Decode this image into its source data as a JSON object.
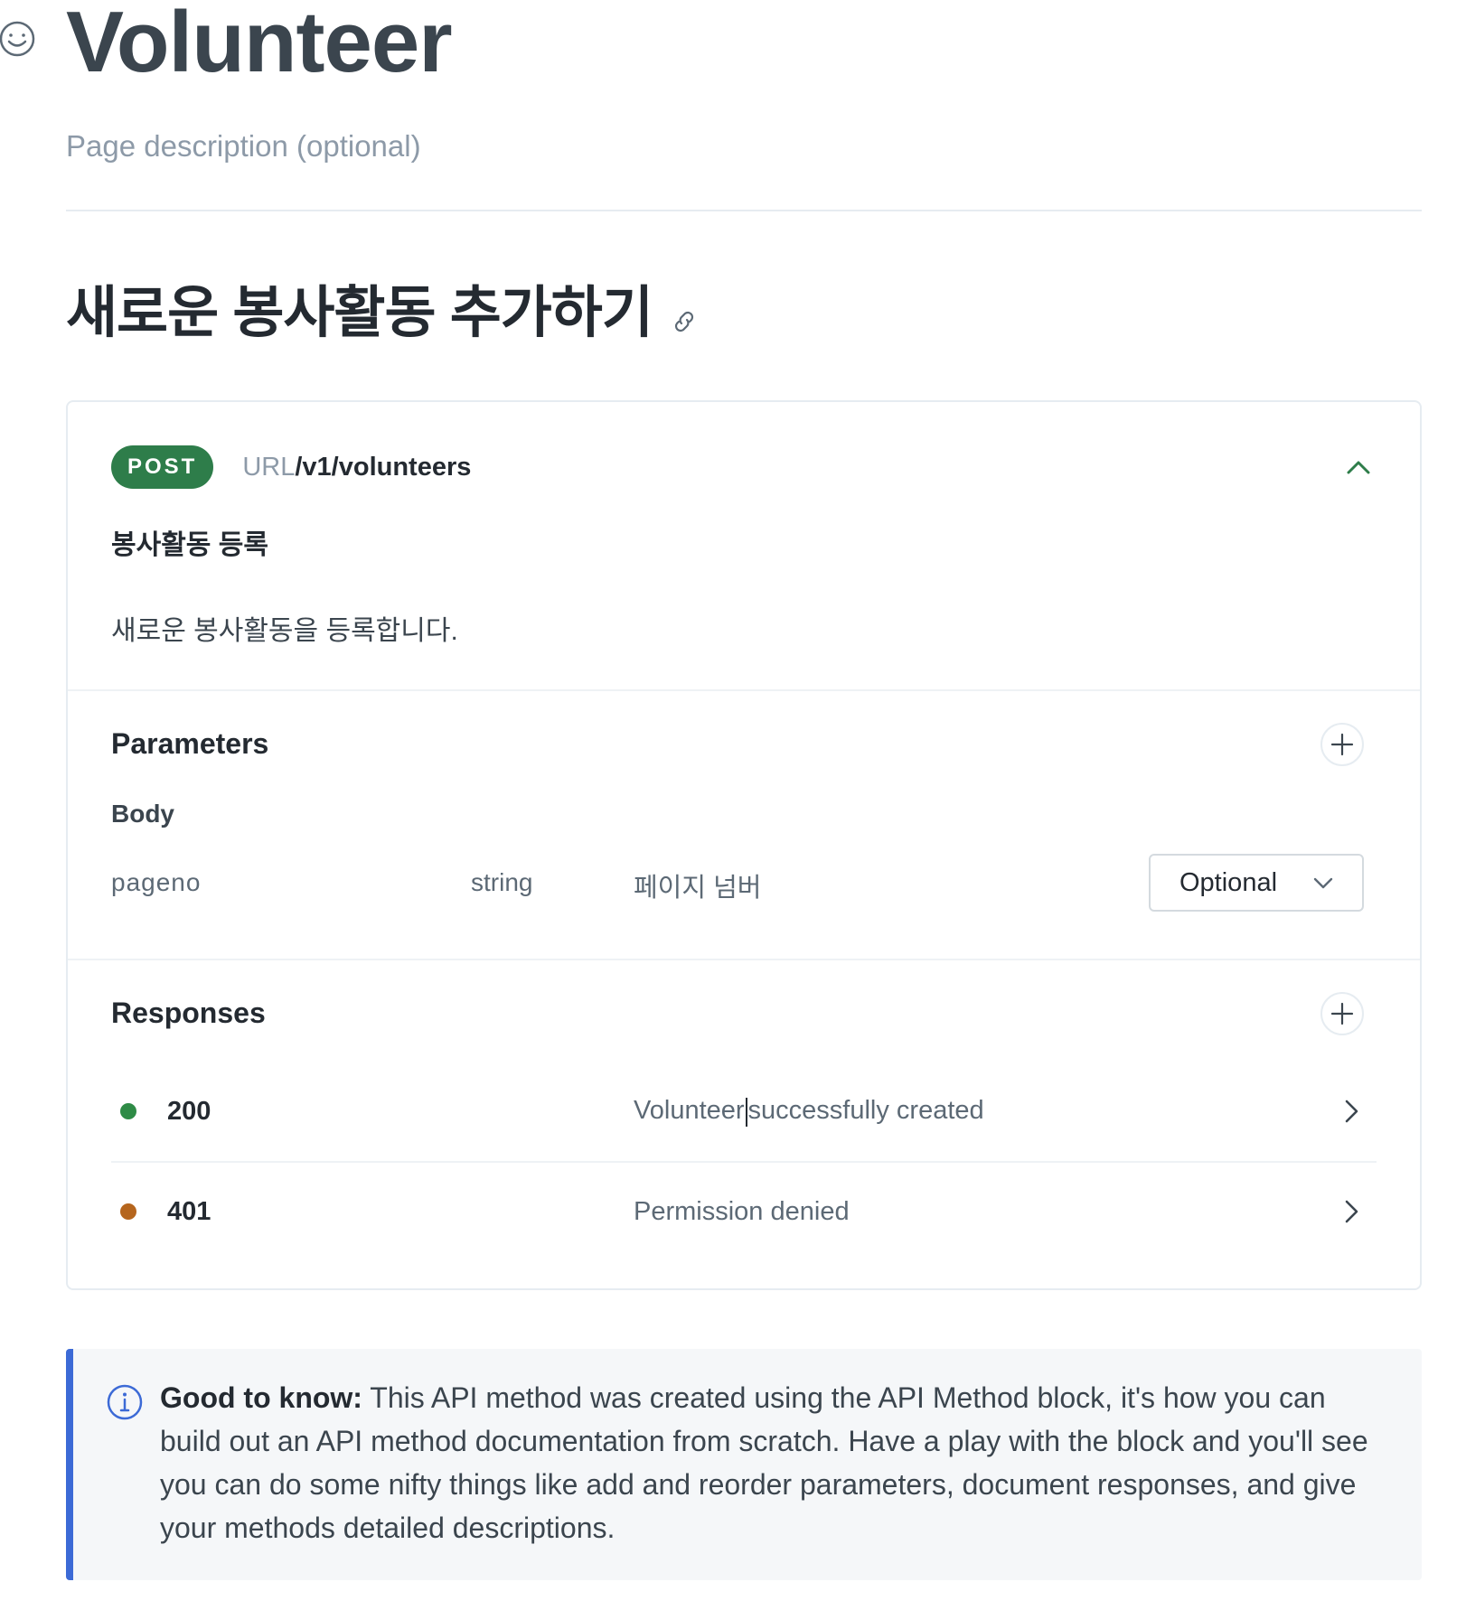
{
  "page": {
    "title": "Volunteer",
    "description_placeholder": "Page description (optional)"
  },
  "section": {
    "heading": "새로운 봉사활동 추가하기"
  },
  "api_method": {
    "method": "POST",
    "url_label": "URL",
    "path": "/v1/volunteers",
    "name": "봉사활동 등록",
    "description": "새로운 봉사활동을 등록합니다.",
    "colors": {
      "method_badge": "#2e7d4a",
      "status_200": "#2e8b46",
      "status_401": "#b5651d"
    }
  },
  "parameters": {
    "title": "Parameters",
    "body_label": "Body",
    "items": [
      {
        "name": "pageno",
        "type": "string",
        "description": "페이지 넘버",
        "requirement": "Optional"
      }
    ]
  },
  "responses": {
    "title": "Responses",
    "items": [
      {
        "code": "200",
        "description_before_cursor": "Volunteer",
        "description_after_cursor": "successfully created"
      },
      {
        "code": "401",
        "description": "Permission denied"
      }
    ]
  },
  "hint": {
    "label": "Good to know:",
    "text": " This API method was created using the API Method block, it's how you can build out an API method documentation from scratch. Have a play with the block and you'll see you can do some nifty things like add and reorder parameters, document responses, and give your methods detailed descriptions.",
    "accent_color": "#3c6ad6"
  }
}
